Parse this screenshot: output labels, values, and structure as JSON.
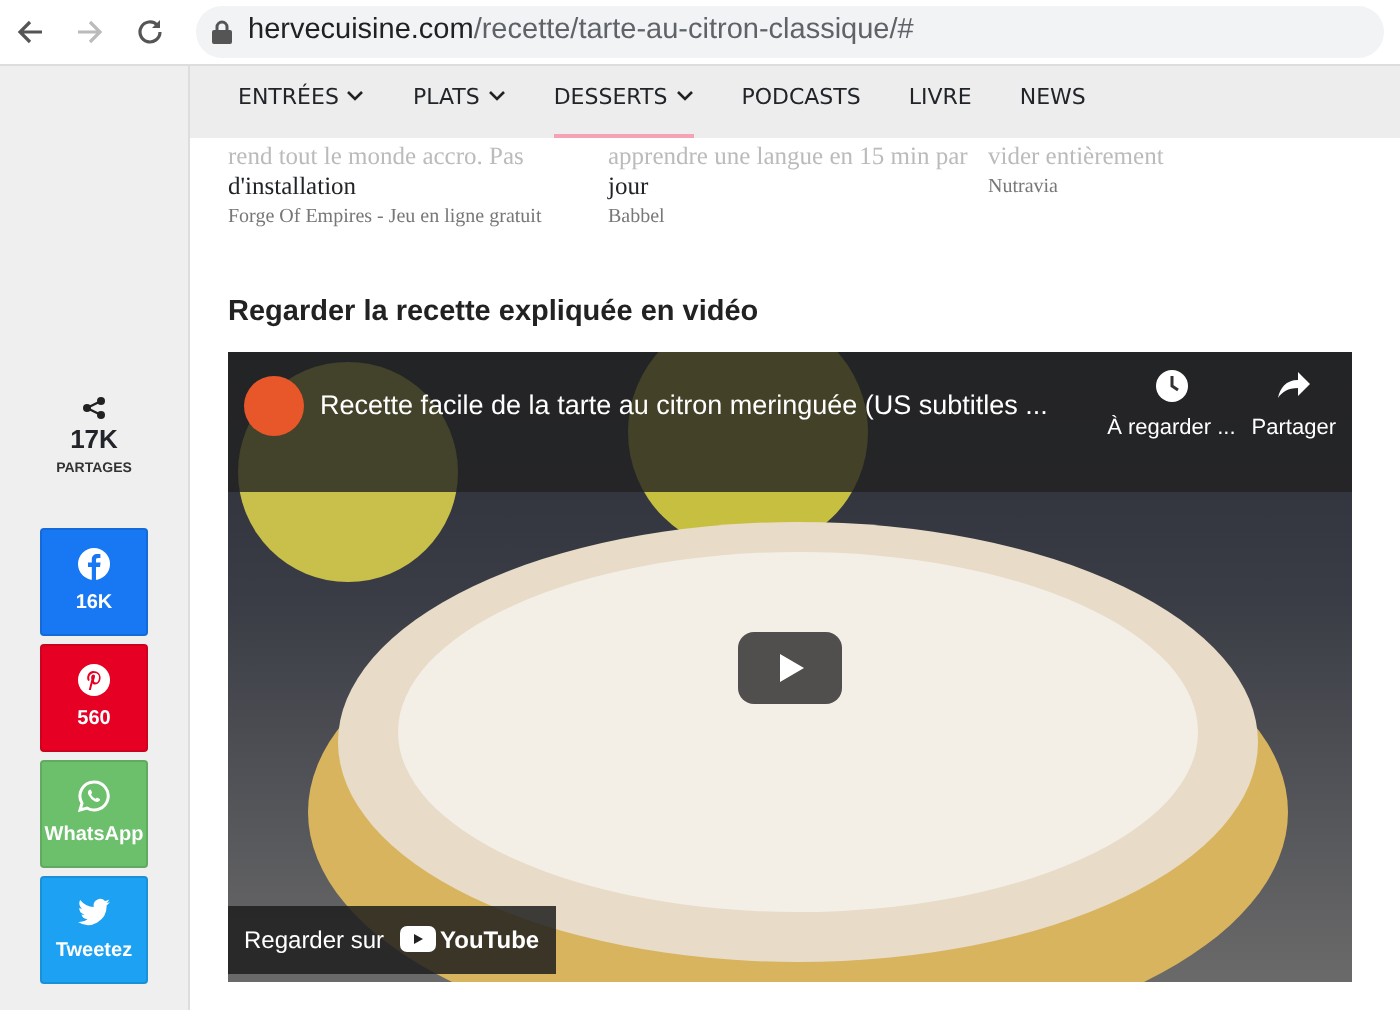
{
  "browser": {
    "url_host": "hervecuisine.com",
    "url_path": "/recette/tarte-au-citron-classique/#"
  },
  "nav": [
    {
      "label": "ENTRÉES",
      "dropdown": true,
      "selected": false
    },
    {
      "label": "PLATS",
      "dropdown": true,
      "selected": false
    },
    {
      "label": "DESSERTS",
      "dropdown": true,
      "selected": true
    },
    {
      "label": "PODCASTS",
      "dropdown": false,
      "selected": false
    },
    {
      "label": "LIVRE",
      "dropdown": false,
      "selected": false
    },
    {
      "label": "NEWS",
      "dropdown": false,
      "selected": false
    }
  ],
  "ads": [
    {
      "faded": "rend tout le monde accro. Pas",
      "title": "d'installation",
      "source": "Forge Of Empires - Jeu en ligne gratuit"
    },
    {
      "faded": "apprendre une langue en 15 min par",
      "title": "jour",
      "source": "Babbel"
    },
    {
      "faded": "vider entièrement",
      "source": "Nutravia"
    }
  ],
  "share": {
    "count": "17K",
    "label": "PARTAGES",
    "buttons": [
      {
        "kind": "facebook",
        "label": "16K"
      },
      {
        "kind": "pinterest",
        "label": "560"
      },
      {
        "kind": "whatsapp",
        "label": "WhatsApp"
      },
      {
        "kind": "twitter",
        "label": "Tweetez"
      }
    ]
  },
  "section_title": "Regarder la recette expliquée en vidéo",
  "video": {
    "title": "Recette facile de la tarte au citron meringuée (US subtitles ...",
    "watch_later": "À regarder ...",
    "share": "Partager",
    "watch_on": "Regarder sur",
    "brand": "YouTube"
  }
}
